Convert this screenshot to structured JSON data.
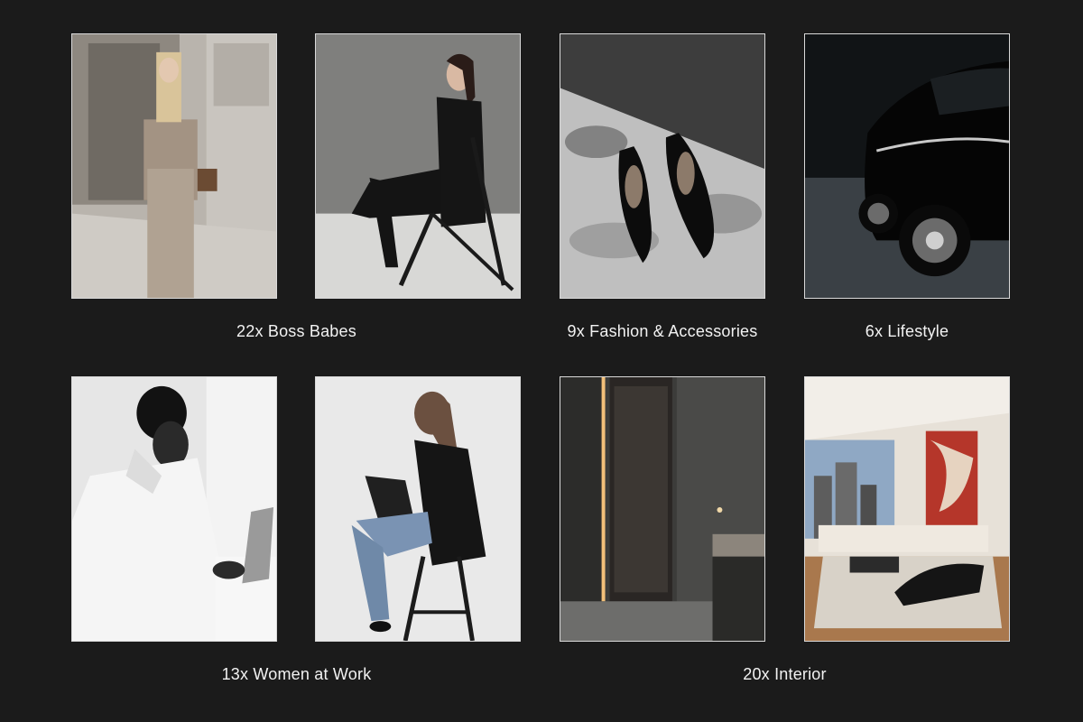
{
  "captions": {
    "boss_babes": "22x Boss Babes",
    "fashion_accessories": "9x Fashion & Accessories",
    "lifestyle": "6x Lifestyle",
    "women_at_work": "13x Women at Work",
    "interior": "20x Interior"
  },
  "colors": {
    "background": "#1b1b1b",
    "caption_text": "#f2f2f2",
    "tile_border": "#d9d9d9"
  }
}
